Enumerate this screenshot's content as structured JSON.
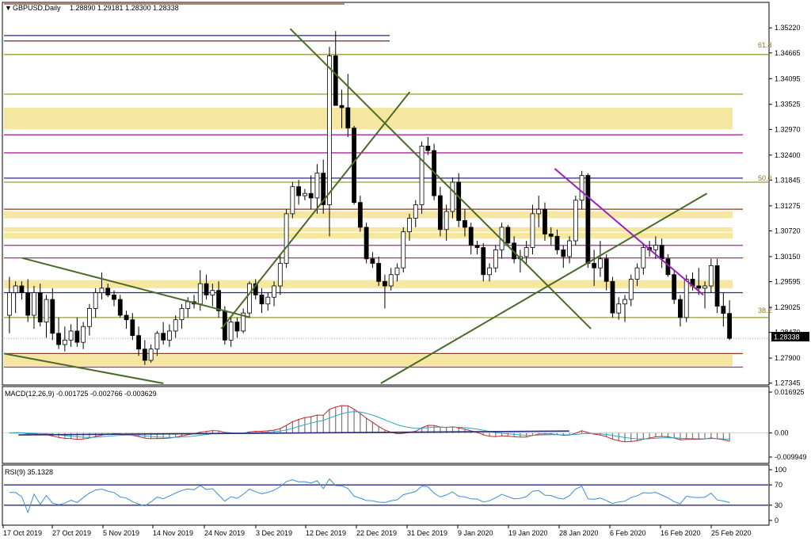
{
  "window": {
    "symbol_title": "GBPUSD,Daily",
    "ohlc_text": "1.28890 1.29181 1.28300 1.28338"
  },
  "colors": {
    "bull": "#ffffff",
    "bear": "#000000",
    "zone": "#f5e7a0",
    "magenta": "#b0259a",
    "brown": "#8b3a1a",
    "olive_line": "#9a9a3a",
    "trend_green": "#4a6a2a",
    "trend_purple": "#9b1fbf",
    "navy": "#2a2a7a",
    "macd_signal": "#c0262a",
    "macd_main": "#2aa7c9",
    "rsi": "#3a8ed6",
    "current_price_bg": "#000000"
  },
  "price_axis": {
    "ticks": [
      "1.35220",
      "1.34665",
      "1.34095",
      "1.33525",
      "1.32970",
      "1.32400",
      "1.31845",
      "1.31275",
      "1.30720",
      "1.30150",
      "1.29595",
      "1.29025",
      "1.28470",
      "1.27900",
      "1.27345"
    ],
    "current_price": "1.28338"
  },
  "date_axis": [
    "17 Oct 2019",
    "27 Oct 2019",
    "5 Nov 2019",
    "14 Nov 2019",
    "24 Nov 2019",
    "3 Dec 2019",
    "12 Dec 2019",
    "22 Dec 2019",
    "31 Dec 2019",
    "9 Jan 2020",
    "19 Jan 2020",
    "28 Jan 2020",
    "6 Feb 2020",
    "16 Feb 2020",
    "25 Feb 2020"
  ],
  "fibo_labels": [
    "61.8",
    "50.0",
    "38.2"
  ],
  "macd": {
    "label": "MACD(12,26,9) -0.001725 -0.002766 -0.003629",
    "ticks": [
      "0.016925",
      "0.00",
      "-0.009949"
    ]
  },
  "rsi": {
    "label": "RSI(9) 35.1328",
    "ticks": [
      "100",
      "70",
      "30",
      "0"
    ]
  },
  "chart_data": {
    "type": "candlestick",
    "title": "GBPUSD,Daily",
    "ylim": [
      1.2734,
      1.3575
    ],
    "x_range": [
      "17 Oct 2019",
      "28 Feb 2020"
    ],
    "last_candle": {
      "open": 1.2889,
      "high": 1.29181,
      "low": 1.283,
      "close": 1.28338
    },
    "horizontal_levels": [
      {
        "price": 1.3575,
        "style": "brown"
      },
      {
        "price": 1.3505,
        "style": "navy"
      },
      {
        "price": 1.3493,
        "style": "brown"
      },
      {
        "price": 1.3463,
        "style": "olive",
        "label": "61.8"
      },
      {
        "price": 1.3375,
        "style": "olive"
      },
      {
        "price": 1.3285,
        "style": "magenta"
      },
      {
        "price": 1.3245,
        "style": "magenta"
      },
      {
        "price": 1.3189,
        "style": "navy"
      },
      {
        "price": 1.318,
        "style": "olive",
        "label": "50.0"
      },
      {
        "price": 1.312,
        "style": "brown"
      },
      {
        "price": 1.304,
        "style": "magenta"
      },
      {
        "price": 1.3012,
        "style": "magenta"
      },
      {
        "price": 1.2935,
        "style": "navy"
      },
      {
        "price": 1.288,
        "style": "olive",
        "label": "38.2"
      },
      {
        "price": 1.28,
        "style": "brown"
      },
      {
        "price": 1.277,
        "style": "magenta"
      }
    ],
    "zones": [
      {
        "from": 1.3297,
        "to": 1.3345
      },
      {
        "from": 1.31,
        "to": 1.3115
      },
      {
        "from": 1.307,
        "to": 1.308
      },
      {
        "from": 1.3055,
        "to": 1.3068
      },
      {
        "from": 1.2945,
        "to": 1.2963
      },
      {
        "from": 1.2772,
        "to": 1.2797
      }
    ],
    "candles": [
      {
        "o": 1.2885,
        "h": 1.297,
        "l": 1.2845,
        "c": 1.2935
      },
      {
        "o": 1.2935,
        "h": 1.296,
        "l": 1.289,
        "c": 1.295
      },
      {
        "o": 1.295,
        "h": 1.296,
        "l": 1.292,
        "c": 1.2935
      },
      {
        "o": 1.2935,
        "h": 1.2965,
        "l": 1.287,
        "c": 1.2885
      },
      {
        "o": 1.2885,
        "h": 1.295,
        "l": 1.2855,
        "c": 1.2935
      },
      {
        "o": 1.2935,
        "h": 1.2955,
        "l": 1.286,
        "c": 1.287
      },
      {
        "o": 1.287,
        "h": 1.293,
        "l": 1.2835,
        "c": 1.292
      },
      {
        "o": 1.292,
        "h": 1.2945,
        "l": 1.283,
        "c": 1.2845
      },
      {
        "o": 1.2845,
        "h": 1.288,
        "l": 1.281,
        "c": 1.282
      },
      {
        "o": 1.282,
        "h": 1.286,
        "l": 1.2805,
        "c": 1.283
      },
      {
        "o": 1.283,
        "h": 1.2865,
        "l": 1.2815,
        "c": 1.285
      },
      {
        "o": 1.285,
        "h": 1.288,
        "l": 1.2815,
        "c": 1.2825
      },
      {
        "o": 1.2825,
        "h": 1.287,
        "l": 1.281,
        "c": 1.286
      },
      {
        "o": 1.286,
        "h": 1.291,
        "l": 1.284,
        "c": 1.29
      },
      {
        "o": 1.29,
        "h": 1.2945,
        "l": 1.288,
        "c": 1.2935
      },
      {
        "o": 1.2935,
        "h": 1.298,
        "l": 1.292,
        "c": 1.2945
      },
      {
        "o": 1.2945,
        "h": 1.2955,
        "l": 1.2925,
        "c": 1.293
      },
      {
        "o": 1.293,
        "h": 1.294,
        "l": 1.2905,
        "c": 1.292
      },
      {
        "o": 1.292,
        "h": 1.293,
        "l": 1.288,
        "c": 1.2885
      },
      {
        "o": 1.2885,
        "h": 1.2895,
        "l": 1.2855,
        "c": 1.2875
      },
      {
        "o": 1.2875,
        "h": 1.289,
        "l": 1.283,
        "c": 1.284
      },
      {
        "o": 1.284,
        "h": 1.286,
        "l": 1.2795,
        "c": 1.281
      },
      {
        "o": 1.281,
        "h": 1.283,
        "l": 1.2775,
        "c": 1.2785
      },
      {
        "o": 1.2785,
        "h": 1.282,
        "l": 1.278,
        "c": 1.281
      },
      {
        "o": 1.281,
        "h": 1.285,
        "l": 1.2795,
        "c": 1.2845
      },
      {
        "o": 1.2845,
        "h": 1.287,
        "l": 1.282,
        "c": 1.283
      },
      {
        "o": 1.283,
        "h": 1.2865,
        "l": 1.2815,
        "c": 1.285
      },
      {
        "o": 1.285,
        "h": 1.2885,
        "l": 1.2835,
        "c": 1.2875
      },
      {
        "o": 1.2875,
        "h": 1.291,
        "l": 1.2855,
        "c": 1.29
      },
      {
        "o": 1.29,
        "h": 1.2925,
        "l": 1.288,
        "c": 1.2915
      },
      {
        "o": 1.2915,
        "h": 1.293,
        "l": 1.29,
        "c": 1.291
      },
      {
        "o": 1.291,
        "h": 1.2985,
        "l": 1.2895,
        "c": 1.2955
      },
      {
        "o": 1.2955,
        "h": 1.2975,
        "l": 1.292,
        "c": 1.293
      },
      {
        "o": 1.293,
        "h": 1.2955,
        "l": 1.2905,
        "c": 1.294
      },
      {
        "o": 1.294,
        "h": 1.296,
        "l": 1.288,
        "c": 1.2895
      },
      {
        "o": 1.2895,
        "h": 1.2905,
        "l": 1.282,
        "c": 1.283
      },
      {
        "o": 1.283,
        "h": 1.288,
        "l": 1.2815,
        "c": 1.287
      },
      {
        "o": 1.287,
        "h": 1.288,
        "l": 1.2835,
        "c": 1.285
      },
      {
        "o": 1.285,
        "h": 1.29,
        "l": 1.2845,
        "c": 1.289
      },
      {
        "o": 1.289,
        "h": 1.296,
        "l": 1.288,
        "c": 1.2955
      },
      {
        "o": 1.2955,
        "h": 1.2965,
        "l": 1.292,
        "c": 1.293
      },
      {
        "o": 1.293,
        "h": 1.2945,
        "l": 1.289,
        "c": 1.291
      },
      {
        "o": 1.291,
        "h": 1.2935,
        "l": 1.2895,
        "c": 1.2925
      },
      {
        "o": 1.2925,
        "h": 1.296,
        "l": 1.2905,
        "c": 1.295
      },
      {
        "o": 1.295,
        "h": 1.302,
        "l": 1.293,
        "c": 1.3
      },
      {
        "o": 1.3,
        "h": 1.312,
        "l": 1.299,
        "c": 1.311
      },
      {
        "o": 1.311,
        "h": 1.318,
        "l": 1.31,
        "c": 1.317
      },
      {
        "o": 1.317,
        "h": 1.3185,
        "l": 1.313,
        "c": 1.315
      },
      {
        "o": 1.315,
        "h": 1.3165,
        "l": 1.314,
        "c": 1.3155
      },
      {
        "o": 1.3155,
        "h": 1.3195,
        "l": 1.312,
        "c": 1.3145
      },
      {
        "o": 1.3145,
        "h": 1.322,
        "l": 1.311,
        "c": 1.32
      },
      {
        "o": 1.32,
        "h": 1.323,
        "l": 1.311,
        "c": 1.313
      },
      {
        "o": 1.313,
        "h": 1.348,
        "l": 1.306,
        "c": 1.346
      },
      {
        "o": 1.346,
        "h": 1.3515,
        "l": 1.339,
        "c": 1.335
      },
      {
        "o": 1.335,
        "h": 1.3385,
        "l": 1.33,
        "c": 1.3345
      },
      {
        "o": 1.3345,
        "h": 1.342,
        "l": 1.328,
        "c": 1.33
      },
      {
        "o": 1.33,
        "h": 1.3305,
        "l": 1.313,
        "c": 1.3135
      },
      {
        "o": 1.3135,
        "h": 1.315,
        "l": 1.307,
        "c": 1.308
      },
      {
        "o": 1.308,
        "h": 1.309,
        "l": 1.3,
        "c": 1.301
      },
      {
        "o": 1.301,
        "h": 1.3025,
        "l": 1.299,
        "c": 1.3
      },
      {
        "o": 1.3,
        "h": 1.3015,
        "l": 1.295,
        "c": 1.296
      },
      {
        "o": 1.296,
        "h": 1.2975,
        "l": 1.29,
        "c": 1.295
      },
      {
        "o": 1.295,
        "h": 1.299,
        "l": 1.294,
        "c": 1.2975
      },
      {
        "o": 1.2975,
        "h": 1.3,
        "l": 1.296,
        "c": 1.299
      },
      {
        "o": 1.299,
        "h": 1.308,
        "l": 1.298,
        "c": 1.307
      },
      {
        "o": 1.307,
        "h": 1.311,
        "l": 1.305,
        "c": 1.31
      },
      {
        "o": 1.31,
        "h": 1.314,
        "l": 1.308,
        "c": 1.313
      },
      {
        "o": 1.313,
        "h": 1.327,
        "l": 1.311,
        "c": 1.326
      },
      {
        "o": 1.326,
        "h": 1.328,
        "l": 1.324,
        "c": 1.325
      },
      {
        "o": 1.325,
        "h": 1.3265,
        "l": 1.314,
        "c": 1.315
      },
      {
        "o": 1.315,
        "h": 1.317,
        "l": 1.306,
        "c": 1.3075
      },
      {
        "o": 1.3075,
        "h": 1.313,
        "l": 1.305,
        "c": 1.3115
      },
      {
        "o": 1.3115,
        "h": 1.319,
        "l": 1.31,
        "c": 1.318
      },
      {
        "o": 1.318,
        "h": 1.32,
        "l": 1.308,
        "c": 1.3095
      },
      {
        "o": 1.3095,
        "h": 1.312,
        "l": 1.306,
        "c": 1.308
      },
      {
        "o": 1.308,
        "h": 1.309,
        "l": 1.302,
        "c": 1.304
      },
      {
        "o": 1.304,
        "h": 1.305,
        "l": 1.302,
        "c": 1.3035
      },
      {
        "o": 1.3035,
        "h": 1.3045,
        "l": 1.296,
        "c": 1.2975
      },
      {
        "o": 1.2975,
        "h": 1.3,
        "l": 1.296,
        "c": 1.299
      },
      {
        "o": 1.299,
        "h": 1.304,
        "l": 1.298,
        "c": 1.303
      },
      {
        "o": 1.303,
        "h": 1.309,
        "l": 1.301,
        "c": 1.308
      },
      {
        "o": 1.308,
        "h": 1.3085,
        "l": 1.304,
        "c": 1.3045
      },
      {
        "o": 1.3045,
        "h": 1.306,
        "l": 1.3,
        "c": 1.301
      },
      {
        "o": 1.301,
        "h": 1.303,
        "l": 1.298,
        "c": 1.3015
      },
      {
        "o": 1.3015,
        "h": 1.305,
        "l": 1.3,
        "c": 1.3035
      },
      {
        "o": 1.3035,
        "h": 1.313,
        "l": 1.302,
        "c": 1.311
      },
      {
        "o": 1.311,
        "h": 1.315,
        "l": 1.308,
        "c": 1.312
      },
      {
        "o": 1.312,
        "h": 1.3135,
        "l": 1.305,
        "c": 1.3065
      },
      {
        "o": 1.3065,
        "h": 1.308,
        "l": 1.304,
        "c": 1.306
      },
      {
        "o": 1.306,
        "h": 1.3075,
        "l": 1.302,
        "c": 1.303
      },
      {
        "o": 1.303,
        "h": 1.304,
        "l": 1.299,
        "c": 1.3015
      },
      {
        "o": 1.3015,
        "h": 1.306,
        "l": 1.3,
        "c": 1.305
      },
      {
        "o": 1.305,
        "h": 1.315,
        "l": 1.304,
        "c": 1.314
      },
      {
        "o": 1.314,
        "h": 1.3205,
        "l": 1.312,
        "c": 1.3195
      },
      {
        "o": 1.3195,
        "h": 1.32,
        "l": 1.299,
        "c": 1.3
      },
      {
        "o": 1.3,
        "h": 1.303,
        "l": 1.295,
        "c": 1.299
      },
      {
        "o": 1.299,
        "h": 1.305,
        "l": 1.297,
        "c": 1.301
      },
      {
        "o": 1.301,
        "h": 1.302,
        "l": 1.294,
        "c": 1.296
      },
      {
        "o": 1.296,
        "h": 1.297,
        "l": 1.288,
        "c": 1.289
      },
      {
        "o": 1.289,
        "h": 1.2925,
        "l": 1.2875,
        "c": 1.291
      },
      {
        "o": 1.291,
        "h": 1.293,
        "l": 1.287,
        "c": 1.292
      },
      {
        "o": 1.292,
        "h": 1.2975,
        "l": 1.2905,
        "c": 1.2965
      },
      {
        "o": 1.2965,
        "h": 1.3,
        "l": 1.295,
        "c": 1.299
      },
      {
        "o": 1.299,
        "h": 1.3045,
        "l": 1.2975,
        "c": 1.3035
      },
      {
        "o": 1.3035,
        "h": 1.305,
        "l": 1.3015,
        "c": 1.303
      },
      {
        "o": 1.303,
        "h": 1.306,
        "l": 1.301,
        "c": 1.304
      },
      {
        "o": 1.304,
        "h": 1.3055,
        "l": 1.299,
        "c": 1.301
      },
      {
        "o": 1.301,
        "h": 1.302,
        "l": 1.297,
        "c": 1.2975
      },
      {
        "o": 1.2975,
        "h": 1.2985,
        "l": 1.291,
        "c": 1.292
      },
      {
        "o": 1.292,
        "h": 1.293,
        "l": 1.286,
        "c": 1.288
      },
      {
        "o": 1.288,
        "h": 1.2975,
        "l": 1.287,
        "c": 1.2965
      },
      {
        "o": 1.2965,
        "h": 1.298,
        "l": 1.294,
        "c": 1.295
      },
      {
        "o": 1.295,
        "h": 1.299,
        "l": 1.293,
        "c": 1.2945
      },
      {
        "o": 1.2945,
        "h": 1.296,
        "l": 1.29,
        "c": 1.295
      },
      {
        "o": 1.295,
        "h": 1.301,
        "l": 1.2935,
        "c": 1.2995
      },
      {
        "o": 1.2995,
        "h": 1.301,
        "l": 1.289,
        "c": 1.2905
      },
      {
        "o": 1.2905,
        "h": 1.2935,
        "l": 1.286,
        "c": 1.2889
      },
      {
        "o": 1.2889,
        "h": 1.29181,
        "l": 1.283,
        "c": 1.28338
      }
    ],
    "trend_lines": [
      {
        "name": "",
        "style": "trend_green",
        "from": [
          0.025,
          1.3012
        ],
        "to": [
          0.34,
          1.288
        ]
      },
      {
        "name": "",
        "style": "trend_green",
        "from": [
          0.0,
          1.28
        ],
        "to": [
          0.22,
          1.2734
        ]
      },
      {
        "name": "",
        "style": "trend_green",
        "from": [
          0.395,
          1.352
        ],
        "to": [
          0.81,
          1.2855
        ]
      },
      {
        "name": "",
        "style": "trend_green",
        "from": [
          0.3,
          1.2855
        ],
        "to": [
          0.56,
          1.338
        ]
      },
      {
        "name": "",
        "style": "trend_green",
        "from": [
          0.52,
          1.2734
        ],
        "to": [
          0.97,
          1.3155
        ]
      },
      {
        "name": "",
        "style": "trend_purple",
        "from": [
          0.76,
          1.321
        ],
        "to": [
          0.965,
          1.293
        ]
      }
    ]
  }
}
